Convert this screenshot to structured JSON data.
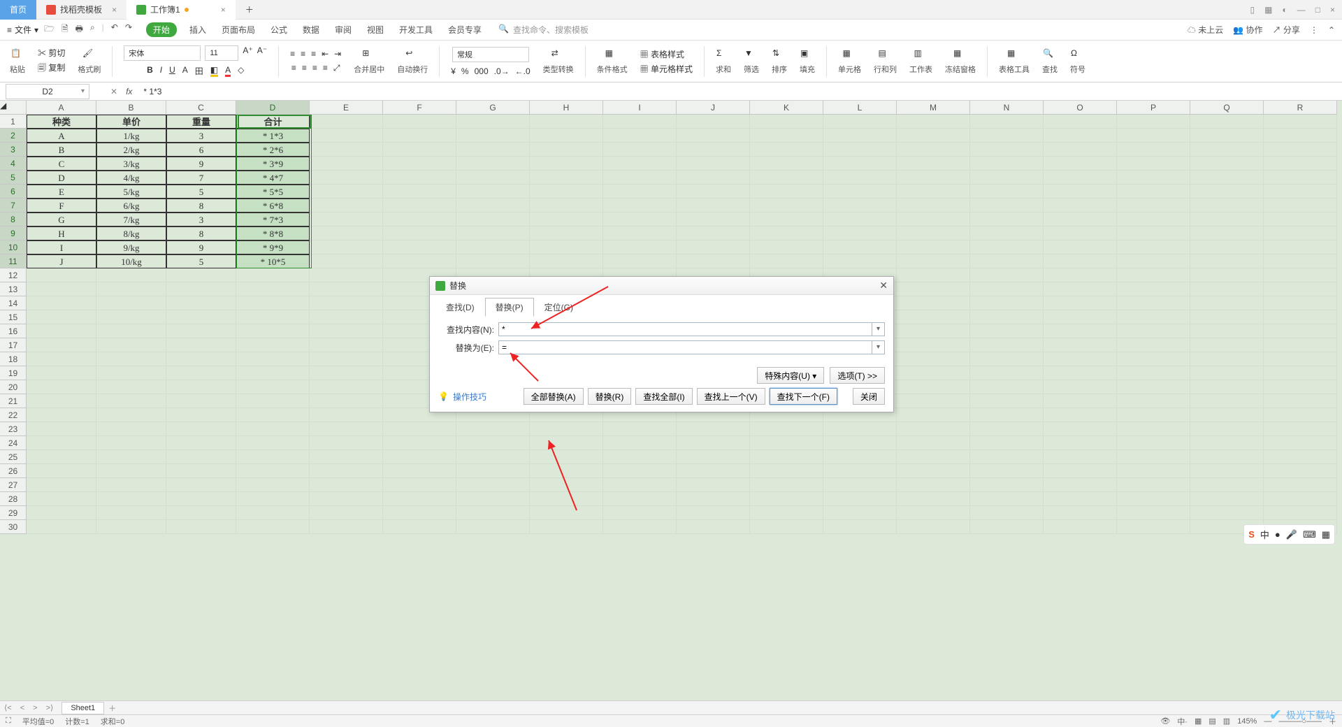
{
  "titlebar": {
    "home": "首页",
    "template_tab": "找稻壳模板",
    "workbook_tab": "工作簿1"
  },
  "menubar": {
    "file": "文件",
    "tabs": [
      "开始",
      "插入",
      "页面布局",
      "公式",
      "数据",
      "审阅",
      "视图",
      "开发工具",
      "会员专享"
    ],
    "search_placeholder": "查找命令、搜索模板",
    "cloud": "未上云",
    "coop": "协作",
    "share": "分享"
  },
  "ribbon": {
    "paste": "粘贴",
    "cut": "剪切",
    "copy": "复制",
    "format_painter": "格式刷",
    "font": "宋体",
    "size": "11",
    "merge": "合并居中",
    "wrap": "自动换行",
    "general": "常规",
    "type_convert": "类型转换",
    "cond_fmt": "条件格式",
    "table_style": "表格样式",
    "cell_style": "单元格样式",
    "sum": "求和",
    "filter": "筛选",
    "sort": "排序",
    "fill": "填充",
    "cells": "单元格",
    "rowcol": "行和列",
    "sheet": "工作表",
    "freeze": "冻结窗格",
    "table_tools": "表格工具",
    "find": "查找",
    "symbol": "符号"
  },
  "namebox": "D2",
  "formula": "* 1*3",
  "columns": [
    "A",
    "B",
    "C",
    "D",
    "E",
    "F",
    "G",
    "H",
    "I",
    "J",
    "K",
    "L",
    "M",
    "N",
    "O",
    "P",
    "Q",
    "R"
  ],
  "rows": 30,
  "table": {
    "headers": [
      "种类",
      "单价",
      "重量",
      "合计"
    ],
    "data": [
      [
        "A",
        "1/kg",
        "3",
        "* 1*3"
      ],
      [
        "B",
        "2/kg",
        "6",
        "* 2*6"
      ],
      [
        "C",
        "3/kg",
        "9",
        "* 3*9"
      ],
      [
        "D",
        "4/kg",
        "7",
        "* 4*7"
      ],
      [
        "E",
        "5/kg",
        "5",
        "* 5*5"
      ],
      [
        "F",
        "6/kg",
        "8",
        "* 6*8"
      ],
      [
        "G",
        "7/kg",
        "3",
        "* 7*3"
      ],
      [
        "H",
        "8/kg",
        "8",
        "* 8*8"
      ],
      [
        "I",
        "9/kg",
        "9",
        "* 9*9"
      ],
      [
        "J",
        "10/kg",
        "5",
        "* 10*5"
      ]
    ]
  },
  "dialog": {
    "title": "替换",
    "tabs": [
      "查找(D)",
      "替换(P)",
      "定位(G)"
    ],
    "find_label": "查找内容(N):",
    "replace_label": "替换为(E):",
    "find_value": "*",
    "replace_value": "=",
    "special": "特殊内容(U)",
    "options": "选项(T) >>",
    "replace_all": "全部替换(A)",
    "replace": "替换(R)",
    "find_all": "查找全部(I)",
    "find_prev": "查找上一个(V)",
    "find_next": "查找下一个(F)",
    "close": "关闭",
    "tips": "操作技巧"
  },
  "sheet": {
    "name": "Sheet1"
  },
  "status": {
    "avg": "平均值=0",
    "count": "计数=1",
    "sum": "求和=0",
    "zoom": "145%"
  },
  "ime": {
    "lang": "中"
  },
  "watermark": "极光下载站"
}
